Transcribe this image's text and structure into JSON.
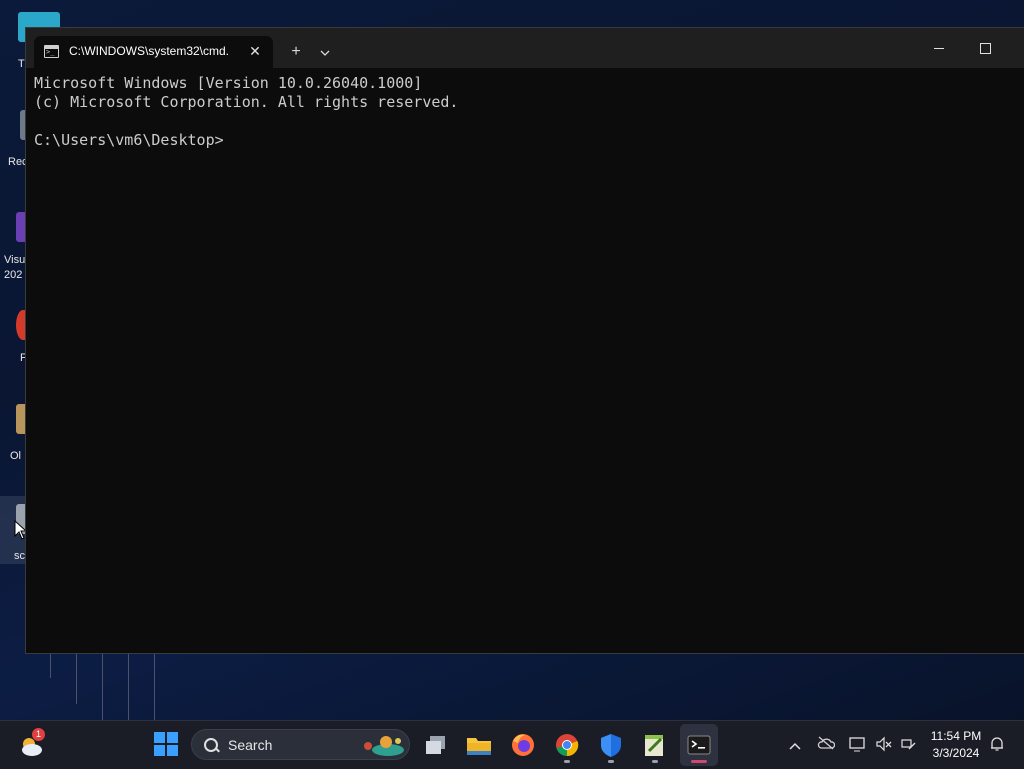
{
  "desktop": {
    "icons": [
      {
        "label": "T"
      },
      {
        "label": "Rec"
      },
      {
        "label": "Visu"
      },
      {
        "label": "202"
      },
      {
        "label": "F"
      },
      {
        "label": "Ol"
      },
      {
        "label": "sc"
      }
    ]
  },
  "window": {
    "tab_title": "C:\\WINDOWS\\system32\\cmd.",
    "tab_close": "✕",
    "new_tab": "+",
    "dropdown": "⌄",
    "minimize": "—",
    "console_lines": [
      "Microsoft Windows [Version 10.0.26040.1000]",
      "(c) Microsoft Corporation. All rights reserved.",
      "",
      "C:\\Users\\vm6\\Desktop>"
    ]
  },
  "taskbar": {
    "search_label": "Search",
    "weather_badge": "1",
    "clock_time": "11:54 PM",
    "clock_date": "3/3/2024",
    "icons": [
      "weather-icon",
      "windows-start-icon",
      "task-view-icon",
      "file-explorer-icon",
      "firefox-icon",
      "chrome-icon",
      "defender-icon",
      "notepad-plus-icon",
      "terminal-icon",
      "chevron-up-icon",
      "onedrive-icon",
      "display-icon",
      "volume-muted-icon",
      "network-icon",
      "notification-bell-icon"
    ]
  },
  "colors": {
    "console_bg": "#0c0c0c",
    "titlebar_bg": "#1f1f1f",
    "taskbar_bg": "#1a1d26",
    "console_text": "#cccccc"
  }
}
